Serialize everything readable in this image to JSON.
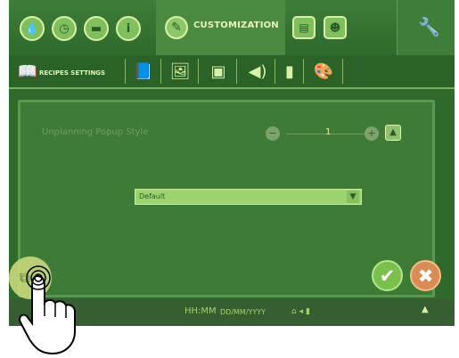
{
  "top_tabs": {
    "icons": [
      "water-drop-icon",
      "clock-icon",
      "folder-icon",
      "info-icon"
    ],
    "active_label": "CUSTOMIZATION",
    "right_tabs": [
      "document-icon",
      "user-icon"
    ]
  },
  "sub_tabs": {
    "active_label": "RECIPES SETTINGS",
    "icons": [
      "book-icon",
      "image-icon",
      "screen-icon",
      "speaker-icon",
      "phone-icon",
      "palette-icon"
    ]
  },
  "setting": {
    "label": "Unplanning Popup Style",
    "value": "1",
    "minus": "−",
    "plus": "+"
  },
  "dropdown": {
    "value": "Default",
    "arrow": "▼"
  },
  "actions": {
    "confirm": "✔",
    "cancel": "✖"
  },
  "status": {
    "time": "HH:MM",
    "date": "DD/MM/YYYY",
    "extras": "⌂ ◂ ▮",
    "up": "▲"
  }
}
